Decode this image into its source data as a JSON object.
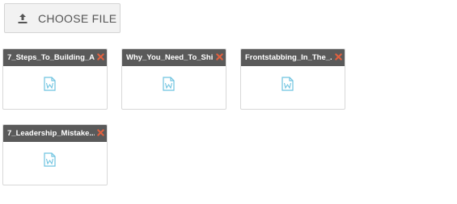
{
  "upload": {
    "button_label": "CHOOSE FILE",
    "icon": "upload-icon"
  },
  "files": [
    {
      "name": "7_Steps_To_Building_A...",
      "icon": "word-document-icon",
      "remove_icon": "close-icon"
    },
    {
      "name": "Why_You_Need_To_Shi...",
      "icon": "word-document-icon",
      "remove_icon": "close-icon"
    },
    {
      "name": "Frontstabbing_In_The_...",
      "icon": "word-document-icon",
      "remove_icon": "close-icon"
    },
    {
      "name": "7_Leadership_Mistake...",
      "icon": "word-document-icon",
      "remove_icon": "close-icon"
    }
  ],
  "colors": {
    "card_header": "#5a5a5a",
    "remove_icon": "#e0603f",
    "doc_icon": "#6ec3e0",
    "button_bg": "#f2f2f2",
    "button_text": "#555555"
  }
}
